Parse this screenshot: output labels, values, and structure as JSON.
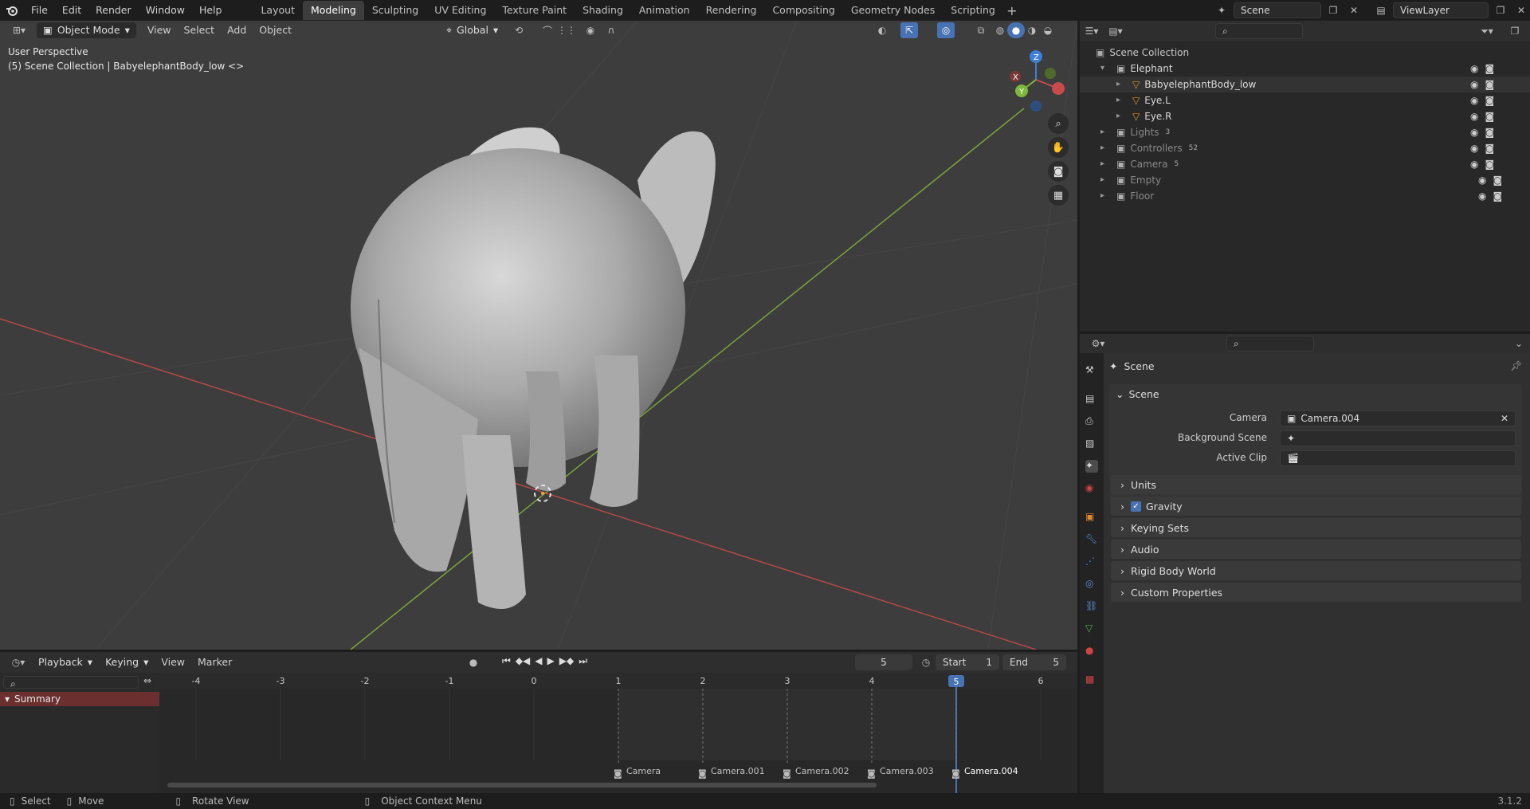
{
  "app_menu": [
    "File",
    "Edit",
    "Render",
    "Window",
    "Help"
  ],
  "workspace_tabs": [
    "Layout",
    "Modeling",
    "Sculpting",
    "UV Editing",
    "Texture Paint",
    "Shading",
    "Animation",
    "Rendering",
    "Compositing",
    "Geometry Nodes",
    "Scripting"
  ],
  "active_workspace": "Modeling",
  "scene_name": "Scene",
  "view_layer": "ViewLayer",
  "viewport": {
    "mode": "Object Mode",
    "menus": [
      "View",
      "Select",
      "Add",
      "Object"
    ],
    "transform_orientation": "Global",
    "view_label": "User Perspective",
    "context_label": "(5) Scene Collection | BabyelephantBody_low <>",
    "gizmo_axes": [
      "X",
      "Y",
      "Z"
    ]
  },
  "outliner": {
    "root": "Scene Collection",
    "items": [
      {
        "label": "Elephant",
        "depth": 0,
        "expanded": true,
        "icon": "collection-icon"
      },
      {
        "label": "BabyelephantBody_low",
        "depth": 1,
        "icon": "mesh-icon"
      },
      {
        "label": "Eye.L",
        "depth": 1,
        "icon": "mesh-icon"
      },
      {
        "label": "Eye.R",
        "depth": 1,
        "icon": "mesh-icon"
      },
      {
        "label": "Lights",
        "depth": 0,
        "icon": "collection-icon",
        "badge": "3",
        "dim": true
      },
      {
        "label": "Controllers",
        "depth": 0,
        "icon": "collection-icon",
        "badge": "52",
        "dim": true
      },
      {
        "label": "Camera",
        "depth": 0,
        "icon": "collection-icon",
        "badge": "5",
        "dim": true
      },
      {
        "label": "Empty",
        "depth": 0,
        "icon": "collection-icon",
        "dim": true
      },
      {
        "label": "Floor",
        "depth": 0,
        "icon": "collection-icon",
        "dim": true
      }
    ]
  },
  "properties": {
    "context_title": "Scene",
    "panel_title": "Scene",
    "camera_label": "Camera",
    "camera_value": "Camera.004",
    "background_scene_label": "Background Scene",
    "active_clip_label": "Active Clip",
    "subpanels": [
      "Units",
      "Gravity",
      "Keying Sets",
      "Audio",
      "Rigid Body World",
      "Custom Properties"
    ],
    "gravity_checked": true
  },
  "timeline": {
    "menus": [
      "Playback",
      "Keying",
      "View",
      "Marker"
    ],
    "current_frame": "5",
    "start_label": "Start",
    "start_value": "1",
    "end_label": "End",
    "end_value": "5",
    "frame_ticks": [
      "-4",
      "-3",
      "-2",
      "-1",
      "0",
      "1",
      "2",
      "3",
      "4",
      "5",
      "6"
    ],
    "summary_label": "Summary",
    "markers": [
      "Camera",
      "Camera.001",
      "Camera.002",
      "Camera.003",
      "Camera.004"
    ]
  },
  "statusbar": {
    "items": [
      "Select",
      "Move",
      "Rotate View",
      "Object Context Menu"
    ],
    "version": "3.1.2"
  },
  "colors": {
    "accent_blue": "#4772b3",
    "x_axis": "#c84a4a",
    "y_axis": "#7fb83d",
    "z_axis": "#3d7fd6"
  }
}
